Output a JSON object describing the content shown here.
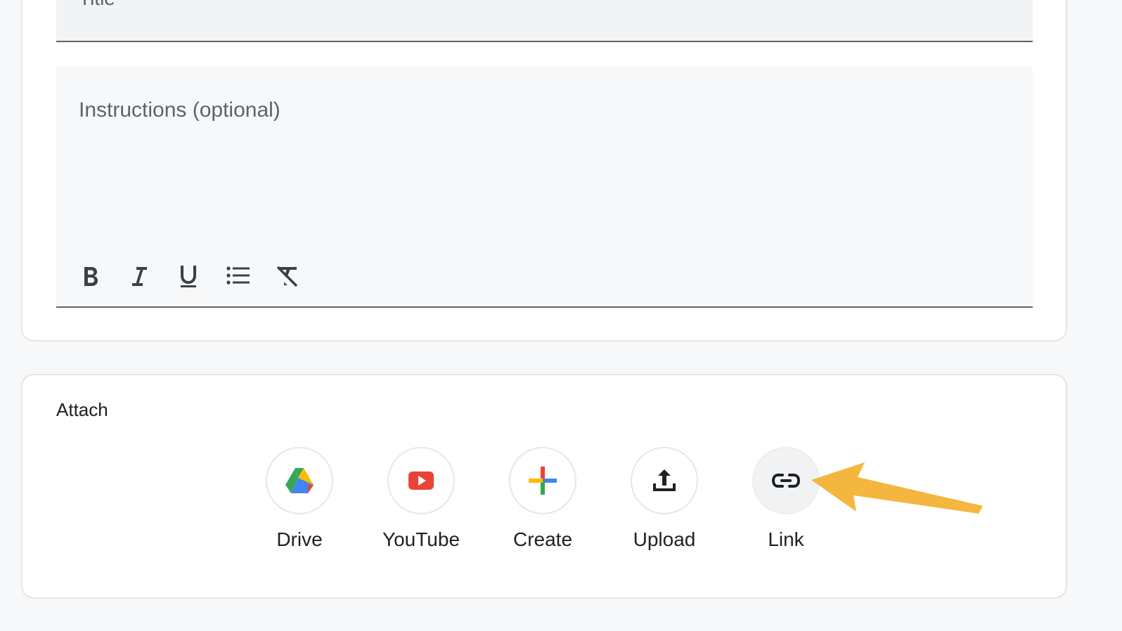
{
  "form": {
    "title_placeholder": "Title",
    "instructions_placeholder": "Instructions (optional)"
  },
  "toolbar": {
    "items": [
      {
        "icon": "bold-icon"
      },
      {
        "icon": "italic-icon"
      },
      {
        "icon": "underline-icon"
      },
      {
        "icon": "bulleted-list-icon"
      },
      {
        "icon": "clear-formatting-icon"
      }
    ]
  },
  "attach": {
    "label": "Attach",
    "items": [
      {
        "label": "Drive",
        "icon": "google-drive-icon"
      },
      {
        "label": "YouTube",
        "icon": "youtube-icon"
      },
      {
        "label": "Create",
        "icon": "create-plus-icon"
      },
      {
        "label": "Upload",
        "icon": "upload-icon"
      },
      {
        "label": "Link",
        "icon": "link-icon"
      }
    ]
  },
  "colors": {
    "background": "#f7f8fa",
    "card": "#ffffff",
    "placeholder": "#5f6368",
    "annotation_arrow": "#f4b63e",
    "google_blue": "#4285F4",
    "google_red": "#EA4335",
    "google_yellow": "#FBBC04",
    "google_green": "#34A853"
  }
}
